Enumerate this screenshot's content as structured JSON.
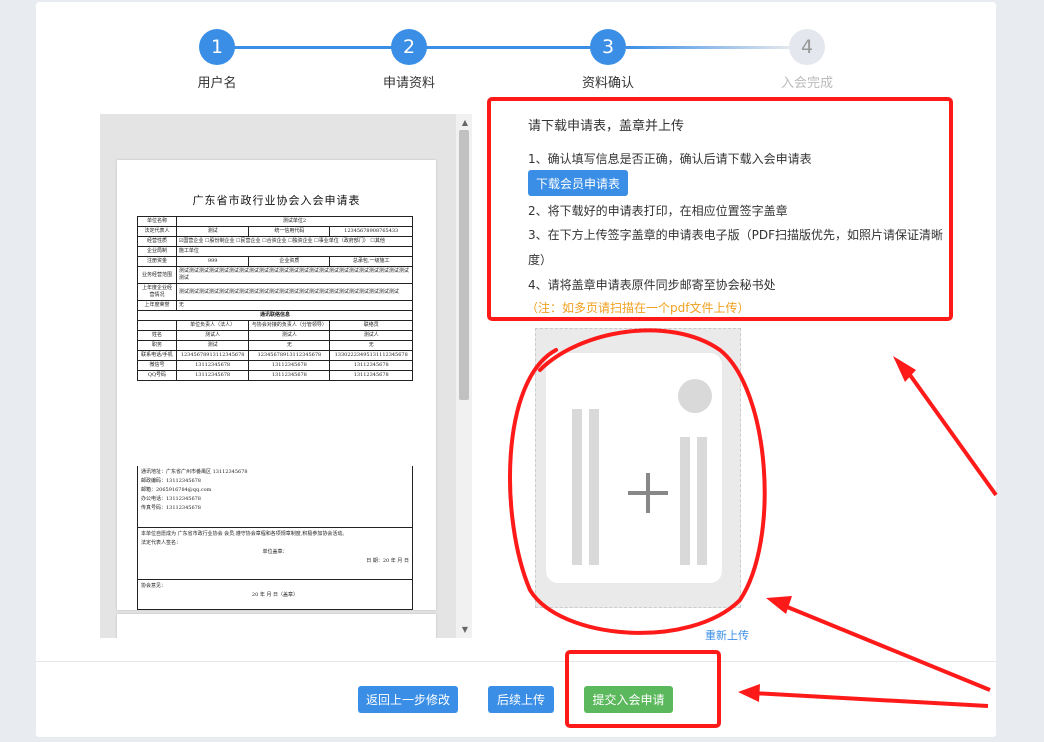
{
  "steps": [
    {
      "number": "1",
      "label": "用户名",
      "state": "done"
    },
    {
      "number": "2",
      "label": "申请资料",
      "state": "done"
    },
    {
      "number": "3",
      "label": "资料确认",
      "state": "active"
    },
    {
      "number": "4",
      "label": "入会完成",
      "state": "pending"
    }
  ],
  "colors": {
    "accent": "#3a8ee6",
    "pending": "#e4e7ed",
    "success": "#5cb85c",
    "note": "#f0a020",
    "annotation": "#ff1a1a"
  },
  "document": {
    "title": "广东省市政行业协会入会申请表",
    "rows": [
      [
        "单位名称",
        "测试单位2"
      ],
      [
        "法定代表人",
        "测试",
        "统一信用代码",
        "12345678908765433"
      ],
      [
        "经营性质",
        "☑国营企业 ☐股份制企业 ☐民营企业 ☐合资企业 ☐独资企业 ☐事业单位（政府部门） ☐其他"
      ],
      [
        "企业局制",
        "施工单位"
      ],
      [
        "注册资金",
        "999",
        "企业资质",
        "总承包,一级施工"
      ],
      [
        "业务经营范围",
        "测试测试测试测试测试测试测试测试测试测试测试测试测试测试测试测试测试测试测试测试测试测试测试测试"
      ],
      [
        "上年度企业经营情况",
        "测试测试测试测试测试测试测试测试测试测试测试测试测试测试测试测试测试测试测试测试测试测试"
      ],
      [
        "上年度荣誉",
        "无"
      ]
    ],
    "contact_header": "通讯联络信息",
    "contact_cols": [
      "",
      "单位负责人（法人）",
      "与协会对接的负责人（分管领导）",
      "联络员"
    ],
    "contact_rows": [
      [
        "姓名",
        "测试人",
        "测试人",
        "测试人"
      ],
      [
        "职务",
        "测试",
        "无",
        "无"
      ],
      [
        "联系电话/手机",
        "12345678913112345678",
        "12345678913112345678",
        "13302223495131112345678"
      ],
      [
        "微信号",
        "13112345678",
        "13112345678",
        "13112345678"
      ],
      [
        "QQ号码",
        "13112345678",
        "13112345678",
        "13112345678"
      ]
    ],
    "address_lines": [
      "通讯地址：广东省广州市番禺区 13112345678",
      "邮政编码：13112345678",
      "邮箱：2065916784@qq.com",
      "办公电话：13112345678",
      "传真号码：13112345678"
    ],
    "declaration_lines": [
      "本单位自愿成为 广东省市政行业协会 会员,遵守协会章程和各项规章制度,积极参加协会活动。",
      "法定代表人签名：",
      "单位盖章：",
      "日 期：20 年 月 日"
    ],
    "opinion_lines": [
      "协会意见：",
      "20 年 月 日（盖章）"
    ]
  },
  "instructions": {
    "heading": "请下载申请表，盖章并上传",
    "step1": "1、确认填写信息是否正确，确认后请下载入会申请表",
    "download_label": "下载会员申请表",
    "step2": "2、将下载好的申请表打印，在相应位置签字盖章",
    "step3a": "3、在下方上传签字盖章的申请表电子版（PDF扫描版优先，如照片请保证清晰",
    "step3b": "度）",
    "step4": "4、请将盖章申请表原件同步邮寄至协会秘书处",
    "note": "（注：如多页请扫描在一个pdf文件上传）"
  },
  "upload": {
    "reupload_label": "重新上传",
    "plus_icon": "plus-icon"
  },
  "footer": {
    "back_label": "返回上一步修改",
    "later_label": "后续上传",
    "submit_label": "提交入会申请"
  }
}
